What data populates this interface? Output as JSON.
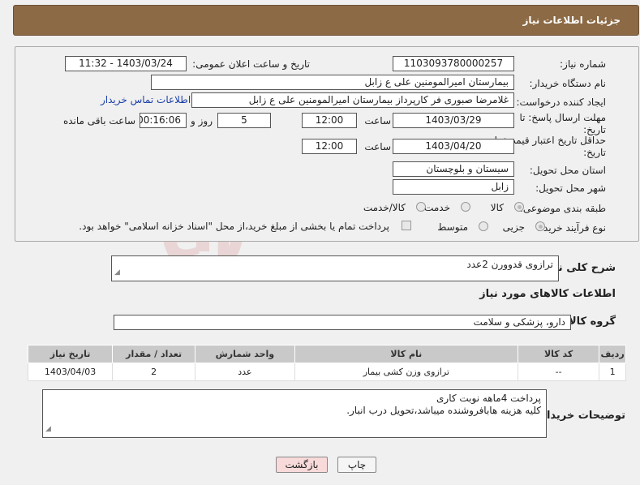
{
  "header": {
    "title": "جزئیات اطلاعات نیاز"
  },
  "form": {
    "need_number_label": "شماره نیاز:",
    "need_number": "1103093780000257",
    "announce_label": "تاریخ و ساعت اعلان عمومی:",
    "announce_value": "1403/03/24 - 11:32",
    "buyer_org_label": "نام دستگاه خریدار:",
    "buyer_org": "بیمارستان امیرالمومنین علی  ع  زابل",
    "creator_label": "ایجاد کننده درخواست:",
    "creator": "غلامرضا صبوری فر کارپرداز بیمارستان امیرالمومنین علی  ع  زابل",
    "buyer_contact_link": "اطلاعات تماس خریدار",
    "deadline_label_1": "مهلت ارسال پاسخ: تا",
    "deadline_label_2": "تاریخ:",
    "deadline_date": "1403/03/29",
    "time_label": "ساعت",
    "deadline_time": "12:00",
    "days_value": "5",
    "days_label": "روز و",
    "remaining_time": "00:16:06",
    "remaining_label": "ساعت باقی مانده",
    "price_validity_label_1": "حداقل تاریخ اعتبار قیمت: تا",
    "price_validity_label_2": "تاریخ:",
    "price_validity_date": "1403/04/20",
    "price_validity_time": "12:00",
    "province_label": "استان محل تحویل:",
    "province": "سیستان و بلوچستان",
    "city_label": "شهر محل تحویل:",
    "city": "زابل",
    "category_label": "طبقه بندی موضوعی:",
    "category_options": [
      "کالا",
      "خدمت",
      "کالا/خدمت"
    ],
    "process_label": "نوع فرآیند خرید :",
    "process_options": [
      "جزیی",
      "متوسط"
    ],
    "payment_note": "پرداخت تمام یا بخشی از مبلغ خرید،از محل \"اسناد خزانه اسلامی\" خواهد بود."
  },
  "description": {
    "label": "شرح کلی نیاز:",
    "value": "ترازوی قدوورن  2عدد"
  },
  "goods_section_title": "اطلاعات کالاهای مورد نیاز",
  "goods_group": {
    "label": "گروه کالا:",
    "value": "دارو، پزشکی و سلامت"
  },
  "table": {
    "headers": [
      "ردیف",
      "کد کالا",
      "نام کالا",
      "واحد شمارش",
      "تعداد / مقدار",
      "تاریخ نیاز"
    ],
    "rows": [
      [
        "1",
        "--",
        "ترازوی وزن کشی بیمار",
        "عدد",
        "2",
        "1403/04/03"
      ]
    ]
  },
  "buyer_notes": {
    "label": "توضیحات خریدار:",
    "line1": "پرداخت 4ماهه نوبت کاری",
    "line2": "کلیه هزینه هابافروشنده میباشد،تحویل درب انبار."
  },
  "buttons": {
    "print": "چاپ",
    "back": "بازگشت"
  },
  "colors": {
    "header_bg": "#8c6a45",
    "link": "#1a3fa8",
    "back_button_bg": "#f8dada"
  }
}
